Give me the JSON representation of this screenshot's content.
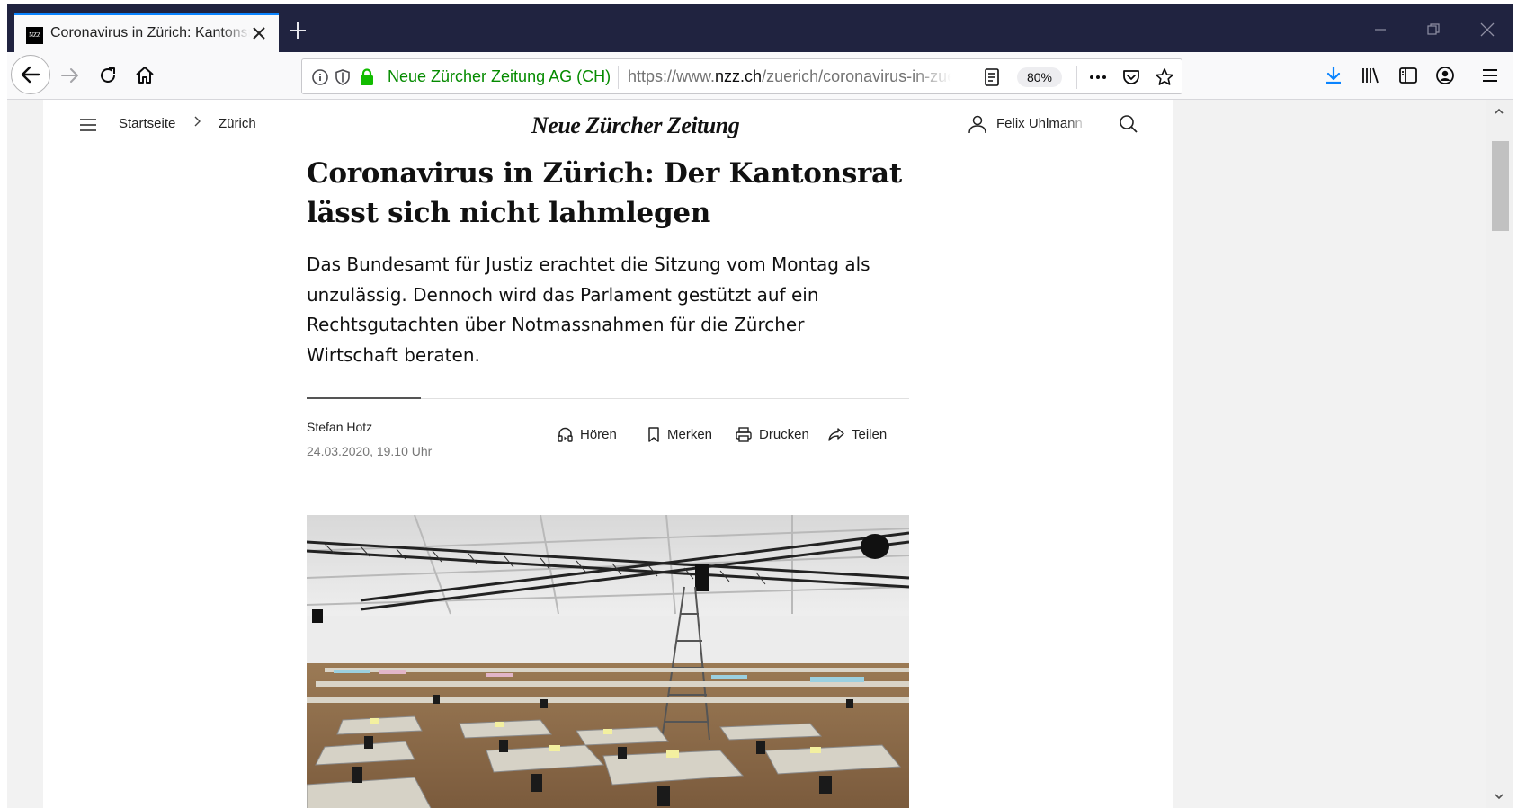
{
  "browser": {
    "tab": {
      "favicon_text": "NZZ",
      "title": "Coronavirus in Zürich: Kantonsrat lässt sich nicht lahmlegen"
    },
    "identity_label": "Neue Zürcher Zeitung AG (CH)",
    "url": {
      "prefix": "https://www.",
      "domain": "nzz.ch",
      "path": "/zuerich/coronavirus-in-zuerich"
    },
    "zoom": "80%",
    "accent_color": "#0a84ff",
    "secure_color": "#058b00"
  },
  "site": {
    "breadcrumb": [
      "Startseite",
      "Zürich"
    ],
    "logo": "Neue Zürcher Zeitung",
    "user_name": "Felix Uhlmann"
  },
  "article": {
    "headline": "Coronavirus in Zürich: Der Kantonsrat lässt sich nicht lahmlegen",
    "lead": "Das Bundesamt für Justiz erachtet die Sitzung vom Montag als unzulässig. Dennoch wird das Parlament gestützt auf ein Rechtsgutachten über Notmassnahmen für die Zürcher Wirtschaft beraten.",
    "author": "Stefan Hotz",
    "date": "24.03.2020, 19.10 Uhr",
    "actions": {
      "listen": "Hören",
      "bookmark": "Merken",
      "print": "Drucken",
      "share": "Teilen"
    }
  }
}
